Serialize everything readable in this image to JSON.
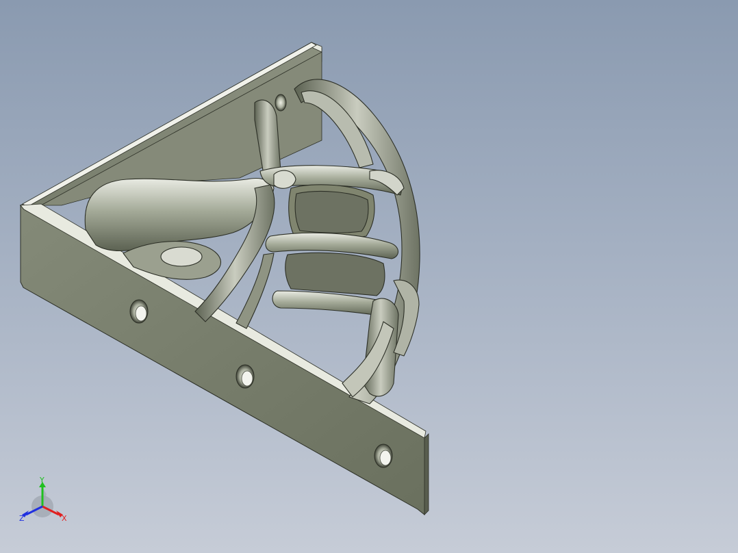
{
  "scene": {
    "background_top": "#8a9ab0",
    "background_bottom": "#c6ccd7",
    "part_color": "#7b8070",
    "lattice_color": "#9aa08e"
  },
  "triad": {
    "x_label": "X",
    "y_label": "Y",
    "z_label": "Z",
    "x_color": "#e02020",
    "y_color": "#20c020",
    "z_color": "#2030e0"
  }
}
